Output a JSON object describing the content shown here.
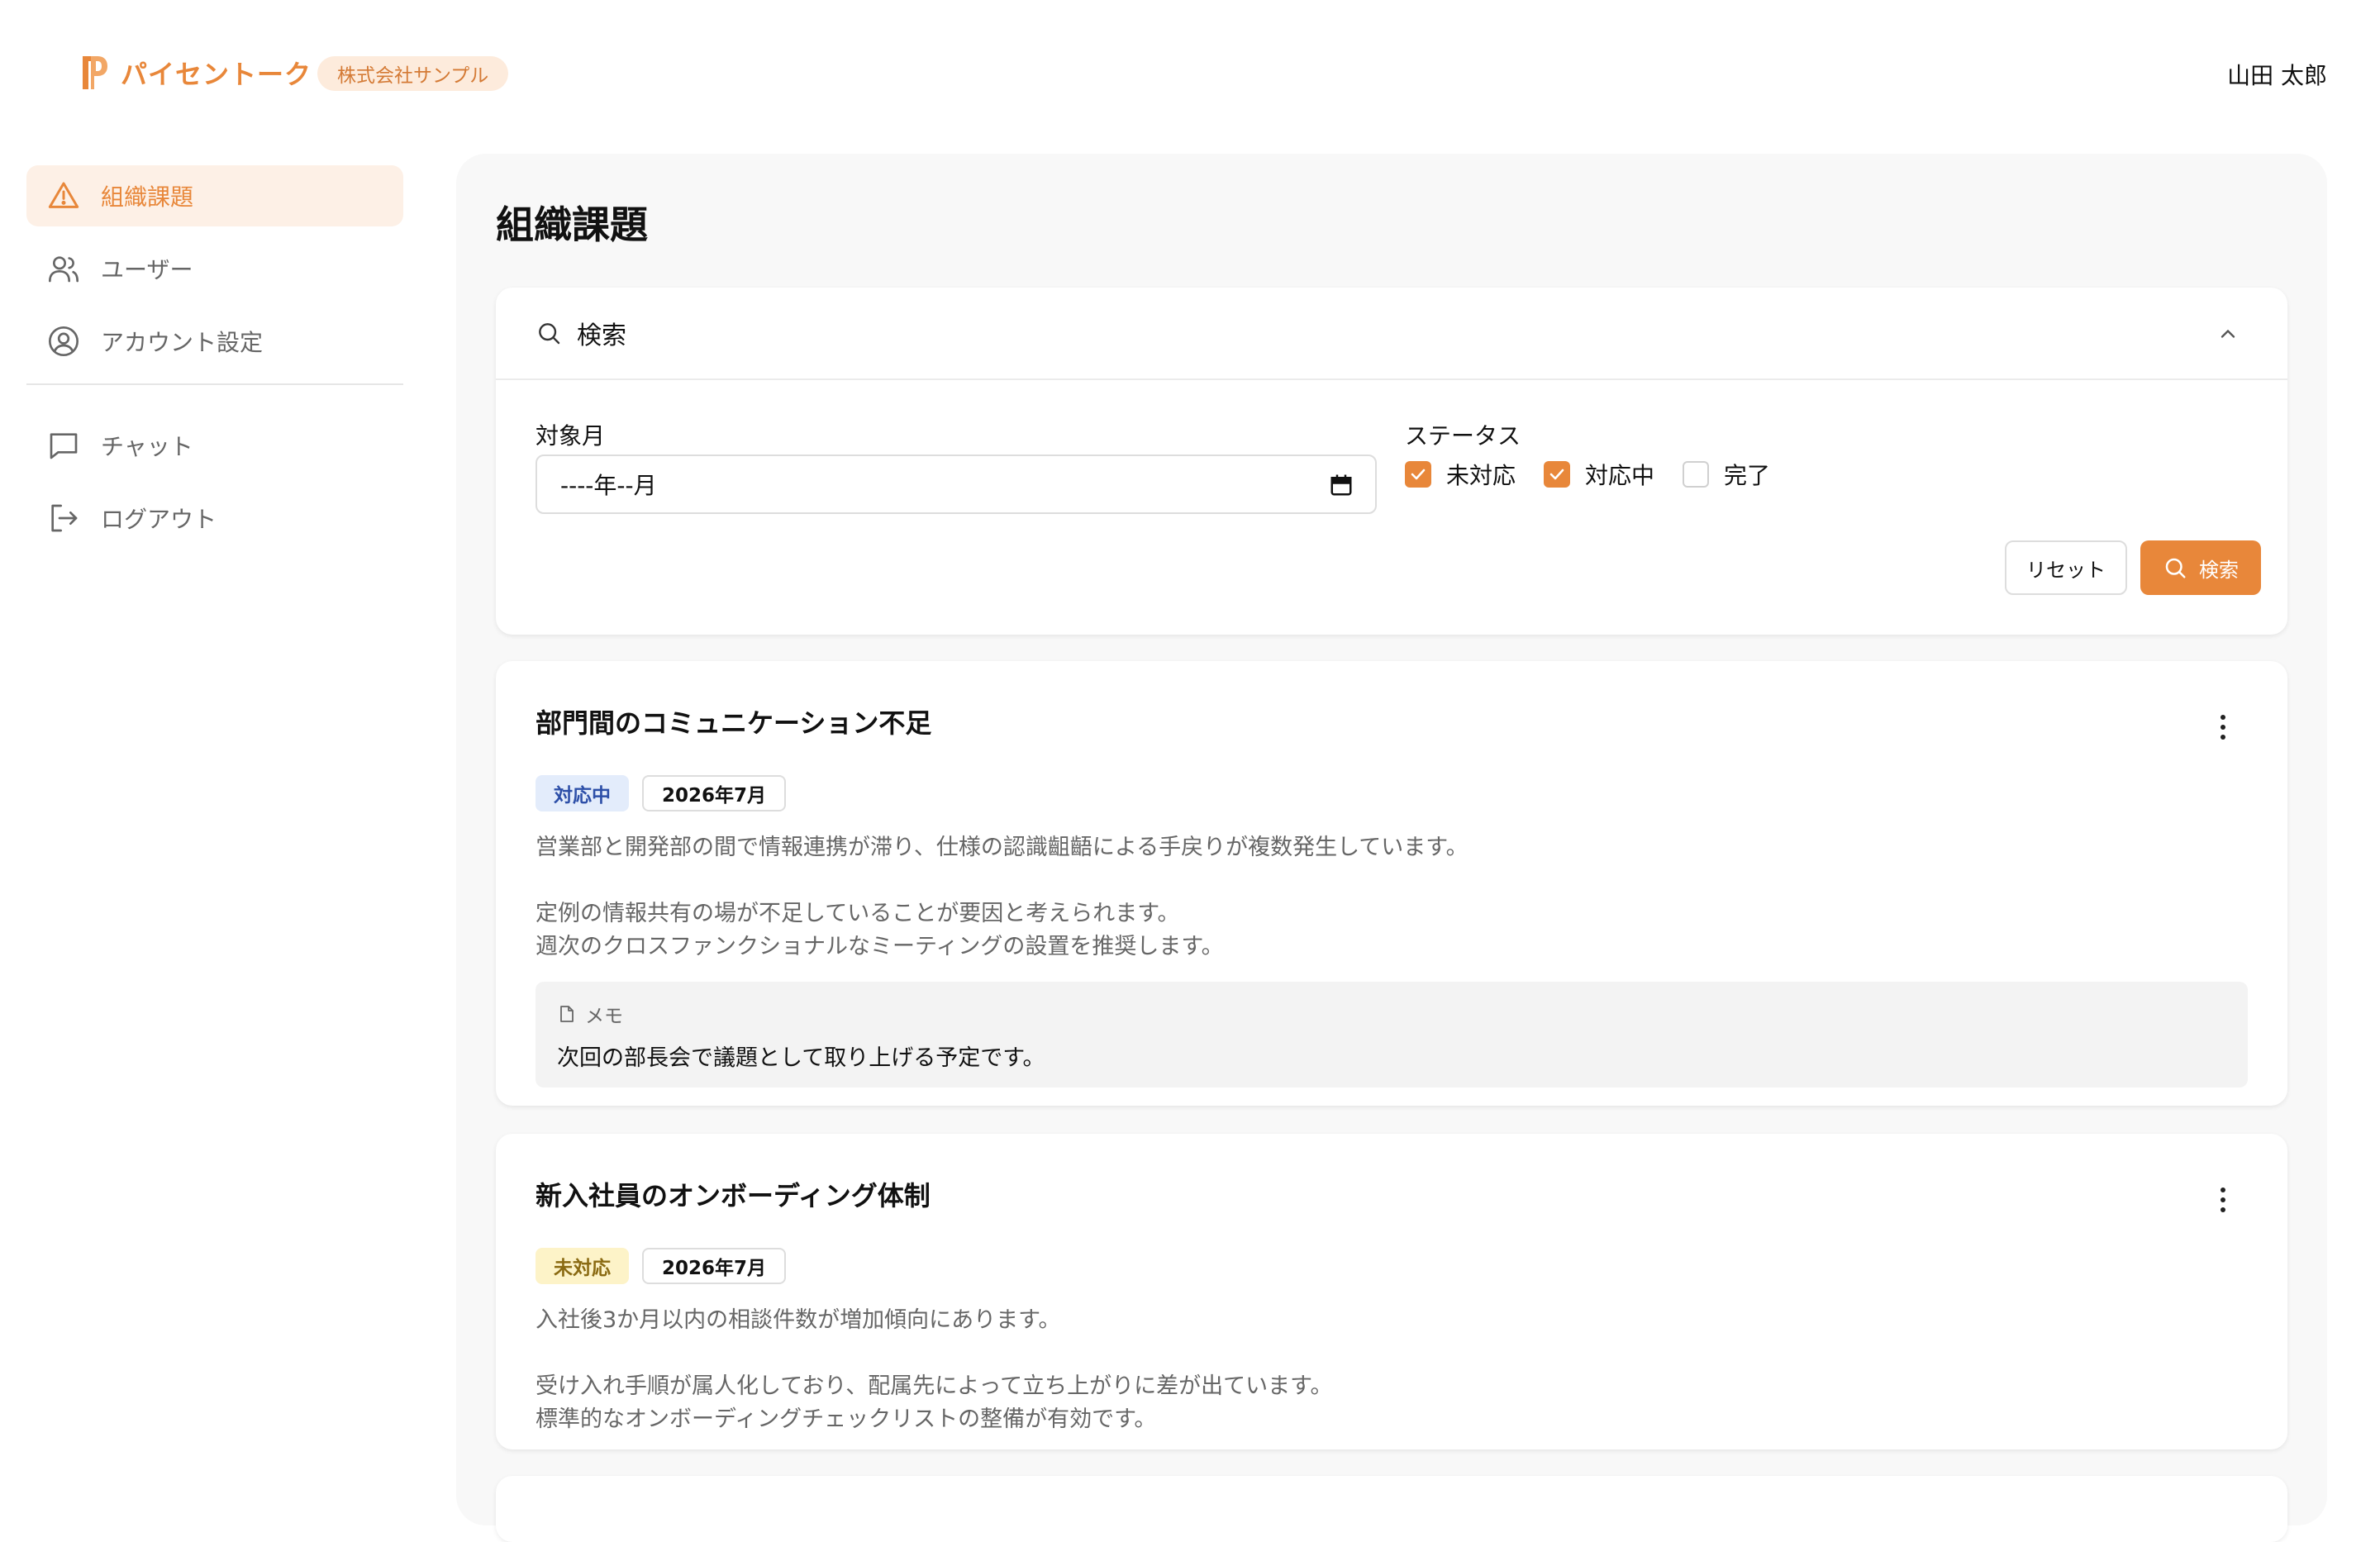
{
  "header": {
    "app_name": "パイセントーク",
    "company": "株式会社サンプル",
    "user_name": "山田 太郎",
    "brand_color": "#E8873A"
  },
  "sidebar": {
    "items": [
      {
        "label": "組織課題",
        "icon": "warning-icon",
        "active": true
      },
      {
        "label": "ユーザー",
        "icon": "users-icon"
      },
      {
        "label": "アカウント設定",
        "icon": "account-circle-icon"
      },
      {
        "label": "チャット",
        "icon": "chat-icon"
      },
      {
        "label": "ログアウト",
        "icon": "logout-icon"
      }
    ]
  },
  "main": {
    "title": "組織課題",
    "search": {
      "header": "検索",
      "month_label": "対象月",
      "month_value": "----年--月",
      "status_label": "ステータス",
      "statuses": [
        {
          "label": "未対応",
          "checked": true
        },
        {
          "label": "対応中",
          "checked": true
        },
        {
          "label": "完了",
          "checked": false
        }
      ],
      "reset_label": "リセット",
      "search_label": "検索"
    },
    "issues": [
      {
        "title": "部門間のコミュニケーション不足",
        "status": "対応中",
        "month": "2026年7月",
        "lines": [
          "営業部と開発部の間で情報連携が滞り、仕様の認識齟齬による手戻りが複数発生しています。",
          "",
          "定例の情報共有の場が不足していることが要因と考えられます。",
          "週次のクロスファンクショナルなミーティングの設置を推奨します。"
        ],
        "memo_label": "メモ",
        "memo": "次回の部長会で議題として取り上げる予定です。"
      },
      {
        "title": "新入社員のオンボーディング体制",
        "status": "未対応",
        "month": "2026年7月",
        "lines": [
          "入社後3か月以内の相談件数が増加傾向にあります。",
          "",
          "受け入れ手順が属人化しており、配属先によって立ち上がりに差が出ています。",
          "標準的なオンボーディングチェックリストの整備が有効です。"
        ]
      }
    ]
  }
}
